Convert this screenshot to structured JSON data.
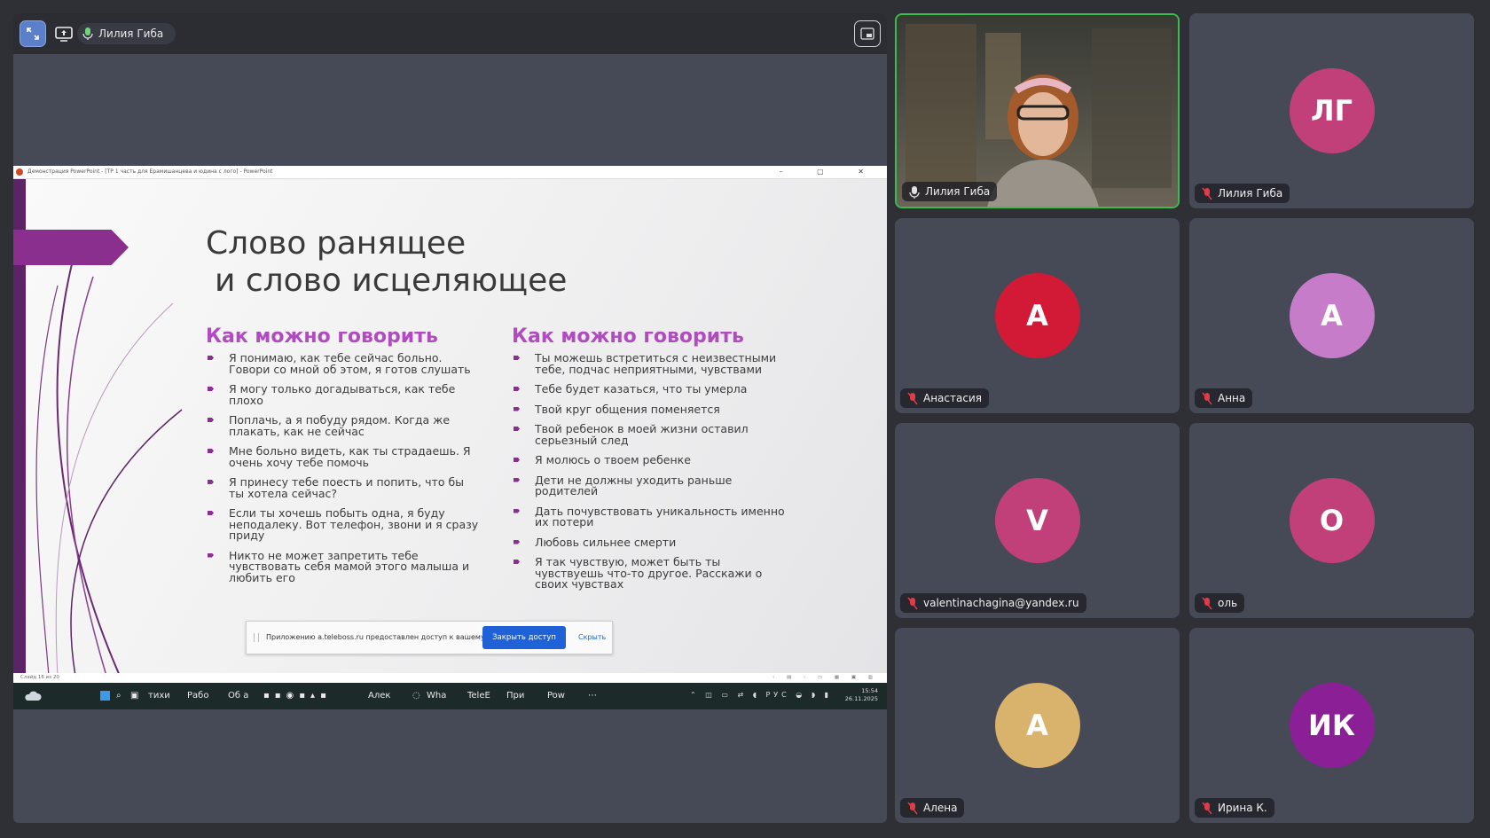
{
  "presenter": {
    "name": "Лилия Гиба"
  },
  "window": {
    "title": "Демонстрация PowerPoint - [ТР 1 часть для Ерамишанцева и юдина с лого] - PowerPoint",
    "controls": "–  ▢  ✕"
  },
  "slide": {
    "title_line1": "Слово ранящее",
    "title_line2": "и слово исцеляющее",
    "col1": {
      "heading": "Как можно говорить",
      "items": [
        "Я понимаю, как тебе сейчас больно. Говори со мной об этом, я готов слушать",
        "Я могу только догадываться, как тебе плохо",
        "Поплачь, а я побуду рядом. Когда же плакать, как не сейчас",
        "Мне больно видеть, как ты страдаешь. Я очень хочу тебе помочь",
        "Я принесу тебе поесть и попить, что бы ты хотела сейчас?",
        "Если ты хочешь побыть одна, я буду неподалеку. Вот телефон, звони и я сразу приду",
        "Никто не может запретить тебе чувствовать себя мамой этого малыша и любить его"
      ]
    },
    "col2": {
      "heading": "Как можно говорить",
      "items": [
        "Ты можешь встретиться с неизвестными тебе, подчас неприятными, чувствами",
        "Тебе  будет казаться, что ты умерла",
        "Твой круг общения поменяется",
        "Твой ребенок в моей жизни оставил серьезный след",
        "Я молюсь о твоем ребенке",
        "Дети не должны уходить раньше родителей",
        "Дать почувствовать уникальность именно их потери",
        "Любовь сильнее смерти",
        "Я так чувствую, может быть ты чувствуешь что-то другое. Расскажи о своих чувствах"
      ]
    }
  },
  "notification": {
    "message": "Приложению a.teleboss.ru предоставлен доступ к вашему экрану.",
    "stop_label": "Закрыть доступ",
    "hide_label": "Скрыть"
  },
  "statusbar": {
    "slide_info": "Слайд 16 из 20",
    "nav": "‹ ▤ ›   ▭ ▦ ▣ ▥"
  },
  "taskbar": {
    "items": [
      "тихи",
      "Рабо",
      "Об а",
      "Алек",
      "Wha",
      "TeleE",
      "При",
      "Pow"
    ],
    "lang": "РУС",
    "time": "15:54",
    "date": "26.11.2025"
  },
  "participants": [
    {
      "name": "Лилия Гиба",
      "video": true,
      "mic": "on"
    },
    {
      "name": "Лилия Гиба",
      "initials": "ЛГ",
      "color": "#c2407a",
      "mic": "off"
    },
    {
      "name": "Анастасия",
      "initials": "А",
      "color": "#d21a36",
      "mic": "off"
    },
    {
      "name": "Анна",
      "initials": "А",
      "color": "#c77cc9",
      "mic": "off"
    },
    {
      "name": "valentinachagina@yandex.ru",
      "initials": "V",
      "color": "#c2407a",
      "mic": "off"
    },
    {
      "name": "оль",
      "initials": "О",
      "color": "#c2407a",
      "mic": "off"
    },
    {
      "name": "Алена",
      "initials": "А",
      "color": "#d9b26b",
      "mic": "off"
    },
    {
      "name": "Ирина К.",
      "initials": "ИК",
      "color": "#8a1f96",
      "mic": "off"
    }
  ]
}
